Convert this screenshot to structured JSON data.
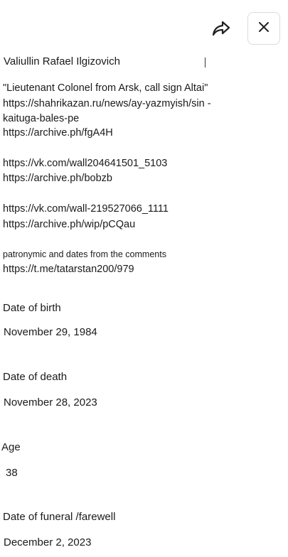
{
  "header": {
    "share_icon": "share-icon",
    "close_icon": "close-icon"
  },
  "person": {
    "name": "Valiullin Rafael Ilgizovich"
  },
  "sources": {
    "line1": "\"Lieutenant Colonel from Arsk, call sign Altai\"",
    "line2": "https://shahrikazan.ru/news/ay-yazmyish/sin -",
    "line3": "kaituga-bales-pe",
    "line4": "https://archive.ph/fgA4H",
    "line5": "https://vk.com/wall204641501_5103",
    "line6": "https://archive.ph/bobzb",
    "line7": "https://vk.com/wall-219527066_1111",
    "line8": "https://archive.ph/wip/pCQau",
    "note": "patronymic and dates from the comments",
    "line9": "https://t.me/tatarstan200/979"
  },
  "fields": {
    "birth_label": "Date of birth",
    "birth_value": "November 29, 1984",
    "death_label": "Date of death",
    "death_value": "November 28, 2023",
    "age_label": "Age",
    "age_value": "38",
    "funeral_label": "Date of funeral /farewell",
    "funeral_value": "December 2, 2023"
  }
}
